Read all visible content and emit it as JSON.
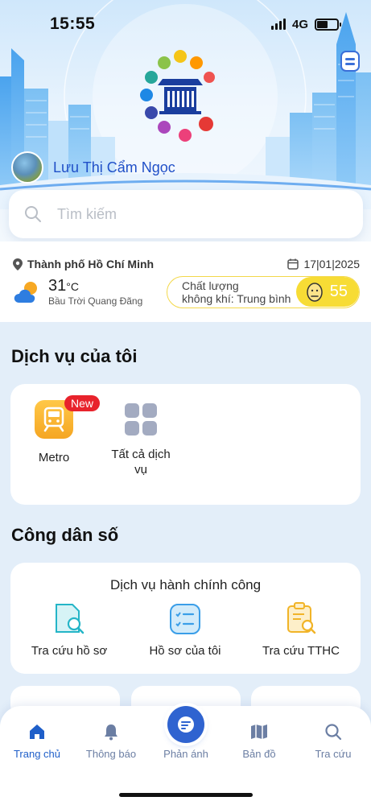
{
  "status_bar": {
    "time": "15:55",
    "network": "4G"
  },
  "user": {
    "name": "Lưu Thị Cẩm Ngọc"
  },
  "search": {
    "placeholder": "Tìm kiếm"
  },
  "info": {
    "location": "Thành phố Hồ Chí Minh",
    "date": "17|01|2025",
    "temperature": "31",
    "temperature_unit": "°C",
    "weather": "Bầu Trời Quang Đãng",
    "air_quality_label_line1": "Chất lượng",
    "air_quality_label_line2": "không khí: Trung bình",
    "air_quality_value": "55",
    "air_quality_color": "#f7dc35"
  },
  "my_services": {
    "title": "Dịch vụ của tôi",
    "items": [
      {
        "label": "Metro",
        "badge": "New",
        "icon": "metro-train-icon"
      },
      {
        "label_line1": "Tất cả dịch",
        "label_line2": "vụ",
        "icon": "grid-icon"
      }
    ]
  },
  "digital_citizen": {
    "title": "Công dân số",
    "card_heading": "Dịch vụ hành chính công",
    "items": [
      {
        "label": "Tra cứu hồ sơ",
        "icon": "folder-search-icon"
      },
      {
        "label": "Hồ sơ của tôi",
        "icon": "checklist-icon"
      },
      {
        "label": "Tra cứu TTHC",
        "icon": "clipboard-search-icon"
      }
    ]
  },
  "bottom_nav": {
    "items": [
      {
        "label": "Trang chủ",
        "icon": "home-icon",
        "active": true
      },
      {
        "label": "Thông báo",
        "icon": "bell-icon"
      },
      {
        "label": "Phản ánh",
        "icon": "feedback-icon"
      },
      {
        "label": "Bản đồ",
        "icon": "map-icon"
      },
      {
        "label": "Tra cứu",
        "icon": "search-icon"
      }
    ]
  },
  "colors": {
    "primary": "#2f63d0",
    "background": "#e3eef9",
    "badge_red": "#e8232c"
  }
}
